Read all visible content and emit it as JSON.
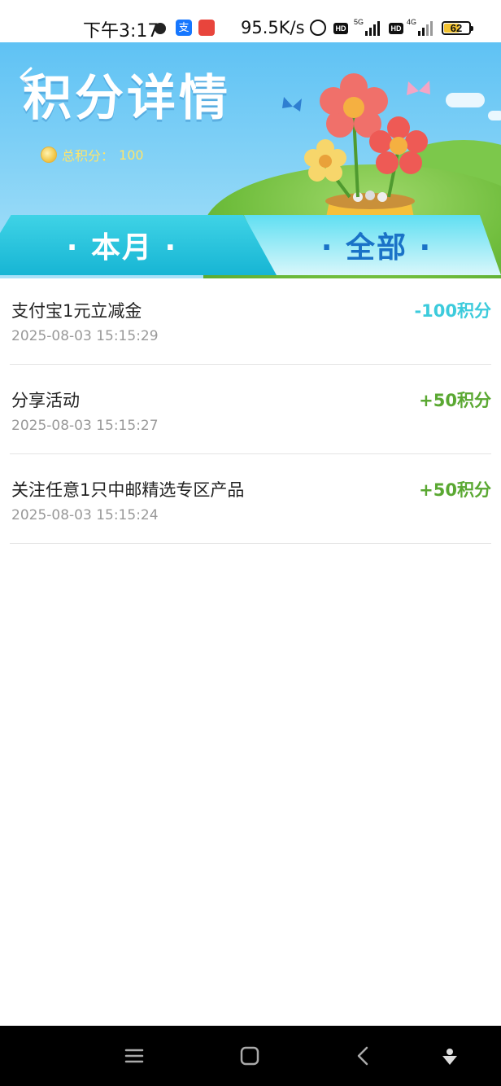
{
  "status_bar": {
    "time": "下午3:17",
    "net_speed": "95.5K/s",
    "hd1": "HD",
    "net1": "5G",
    "hd2": "HD",
    "net2": "4G",
    "battery": "62"
  },
  "header": {
    "title": "积分详情",
    "total_label": "总积分：",
    "total_value": "100"
  },
  "tabs": [
    {
      "label": "· 本月 ·",
      "active": true
    },
    {
      "label": "· 全部 ·",
      "active": false
    }
  ],
  "records": [
    {
      "title": "支付宝1元立减金",
      "time": "2025-08-03 15:15:29",
      "points": "-100积分",
      "color": "#3ccbdc"
    },
    {
      "title": "分享活动",
      "time": "2025-08-03 15:15:27",
      "points": "+50积分",
      "color": "#5aa832"
    },
    {
      "title": "关注任意1只中邮精选专区产品",
      "time": "2025-08-03 15:15:24",
      "points": "+50积分",
      "color": "#5aa832"
    }
  ],
  "navbar": {
    "icons": [
      "menu-icon",
      "home-icon",
      "back-icon",
      "assistant-icon"
    ]
  }
}
